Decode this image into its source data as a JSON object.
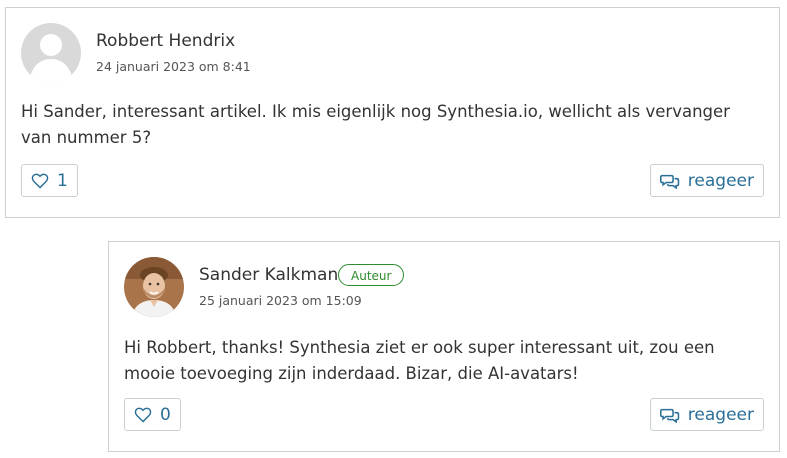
{
  "comments": [
    {
      "author": "Robbert Hendrix",
      "date": "24 januari 2023 om 8:41",
      "text": "Hi Sander, interessant artikel. Ik mis eigenlijk nog Synthesia.io, wellicht als vervanger van nummer 5?",
      "likes": "1",
      "reply_label": "reageer",
      "avatar": "default-user-icon"
    },
    {
      "author": "Sander Kalkman",
      "badge": "Auteur",
      "date": "25 januari 2023 om 15:09",
      "text": "Hi Robbert, thanks! Synthesia ziet er ook super interessant uit, zou een mooie toevoeging zijn inderdaad. Bizar, die AI-avatars!",
      "likes": "0",
      "reply_label": "reageer",
      "avatar": "author-photo"
    }
  ],
  "colors": {
    "accent": "#2a6f97",
    "badge": "#2e8b2e",
    "border": "#cfcfcf"
  }
}
